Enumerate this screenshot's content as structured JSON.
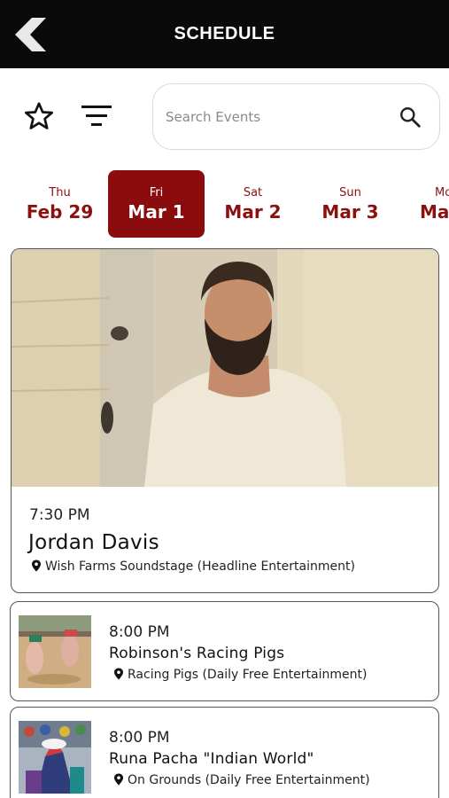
{
  "header": {
    "title": "SCHEDULE",
    "back_icon": "chevron-left-icon"
  },
  "toolbar": {
    "favorites_icon": "star-outline-icon",
    "filter_icon": "filter-icon",
    "search": {
      "placeholder": "Search Events",
      "value": "",
      "icon": "search-icon"
    }
  },
  "dates": [
    {
      "dow": "Thu",
      "date": "Feb 29",
      "active": false
    },
    {
      "dow": "Fri",
      "date": "Mar 1",
      "active": true
    },
    {
      "dow": "Sat",
      "date": "Mar 2",
      "active": false
    },
    {
      "dow": "Sun",
      "date": "Mar 3",
      "active": false
    },
    {
      "dow": "Mo",
      "date": "Ma",
      "active": false
    }
  ],
  "featured_event": {
    "time": "7:30 PM",
    "name": "Jordan Davis",
    "location": "Wish Farms Soundstage (Headline Entertainment)"
  },
  "events": [
    {
      "time": "8:00 PM",
      "name": "Robinson's Racing Pigs",
      "location": "Racing Pigs (Daily Free Entertainment)"
    },
    {
      "time": "8:00 PM",
      "name": "Runa Pacha \"Indian World\"",
      "location": "On Grounds (Daily Free Entertainment)"
    }
  ],
  "colors": {
    "accent": "#8b0c0c",
    "header_bg": "#0a0a0a",
    "date_text": "#8b1010"
  }
}
